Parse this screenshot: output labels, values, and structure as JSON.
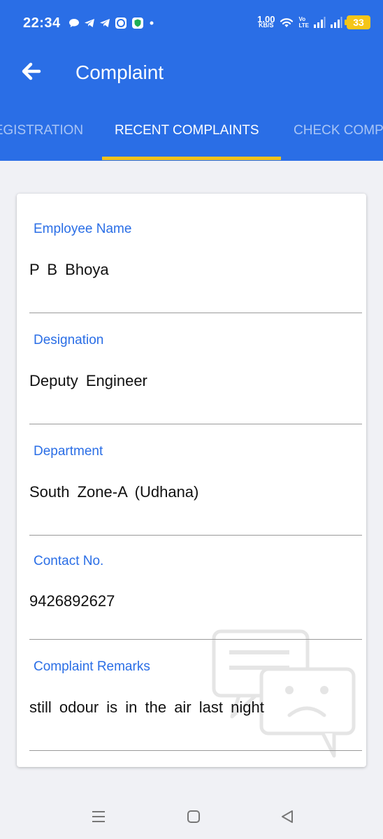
{
  "status_bar": {
    "time": "22:34",
    "net_speed_value": "1.00",
    "net_speed_unit": "KB/S",
    "network_label_top": "Vo",
    "network_label_bottom": "LTE",
    "battery": "33",
    "notification_icons": [
      "chat-bubble-icon",
      "telegram-icon",
      "telegram-icon",
      "app-icon",
      "shield-icon",
      "dot-icon"
    ]
  },
  "app_bar": {
    "title": "Complaint"
  },
  "tabs": [
    {
      "label": "REGISTRATION",
      "active": false
    },
    {
      "label": "RECENT COMPLAINTS",
      "active": true
    },
    {
      "label": "CHECK COMPLAINT",
      "active": false
    }
  ],
  "complaint": {
    "fields": [
      {
        "label": "Employee Name",
        "value": "P B Bhoya"
      },
      {
        "label": "Designation",
        "value": "Deputy Engineer"
      },
      {
        "label": "Department",
        "value": "South Zone-A (Udhana)"
      },
      {
        "label": "Contact No.",
        "value": "9426892627"
      },
      {
        "label": "Complaint Remarks",
        "value": "still odour is in the air last night"
      }
    ]
  },
  "colors": {
    "primary": "#2a6ee6",
    "tab_indicator": "#f2c21b",
    "battery": "#f5c518",
    "background": "#f0f1f5"
  }
}
